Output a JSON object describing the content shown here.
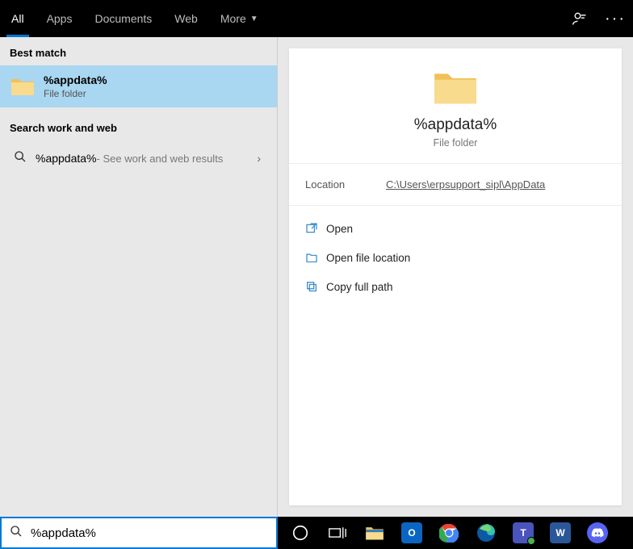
{
  "tabs": {
    "items": [
      "All",
      "Apps",
      "Documents",
      "Web",
      "More"
    ],
    "active_index": 0
  },
  "left": {
    "best_match_header": "Best match",
    "best_match": {
      "title": "%appdata%",
      "subtitle": "File folder"
    },
    "work_web_header": "Search work and web",
    "web_result": {
      "query": "%appdata%",
      "hint": " - See work and web results"
    }
  },
  "preview": {
    "title": "%appdata%",
    "subtitle": "File folder",
    "location_label": "Location",
    "location_value": "C:\\Users\\erpsupport_sipl\\AppData",
    "actions": {
      "open": "Open",
      "open_location": "Open file location",
      "copy_path": "Copy full path"
    }
  },
  "search": {
    "value": "%appdata%"
  },
  "taskbar": {
    "items": [
      {
        "name": "cortana",
        "label": "○",
        "bg": "transparent",
        "fg": "#fff"
      },
      {
        "name": "task-view",
        "label": "⊞",
        "bg": "transparent",
        "fg": "#fff"
      },
      {
        "name": "file-explorer",
        "label": "📁",
        "bg": "transparent",
        "fg": ""
      },
      {
        "name": "outlook",
        "label": "O",
        "bg": "#0a66c2",
        "fg": "#fff"
      },
      {
        "name": "chrome",
        "label": "",
        "bg": "",
        "fg": ""
      },
      {
        "name": "edge",
        "label": "",
        "bg": "",
        "fg": ""
      },
      {
        "name": "teams",
        "label": "T",
        "bg": "#4b53bc",
        "fg": "#fff"
      },
      {
        "name": "word",
        "label": "W",
        "bg": "#2b579a",
        "fg": "#fff"
      },
      {
        "name": "discord",
        "label": "",
        "bg": "#5865f2",
        "fg": "#fff"
      }
    ]
  }
}
